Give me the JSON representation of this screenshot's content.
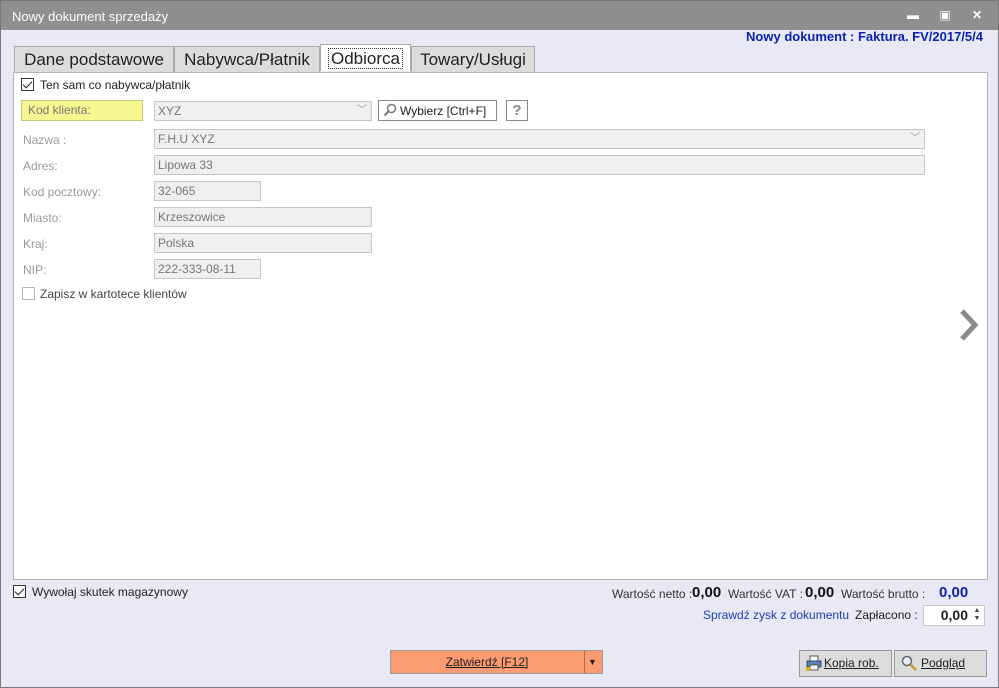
{
  "window": {
    "title": "Nowy dokument sprzedaży",
    "controls": {
      "minimize": "▬",
      "maximize": "▣",
      "close": "✕"
    }
  },
  "doc_header": "Nowy dokument : Faktura. FV/2017/5/4",
  "tabs": [
    {
      "label": "Dane podstawowe",
      "active": false
    },
    {
      "label": "Nabywca/Płatnik",
      "active": false
    },
    {
      "label": "Odbiorca",
      "active": true
    },
    {
      "label": "Towary/Usługi",
      "active": false
    }
  ],
  "form": {
    "same_as_buyer": {
      "label": "Ten sam co nabywca/płatnik",
      "checked": true
    },
    "client_code": {
      "label": "Kod klienta:",
      "value": "XYZ"
    },
    "choose_button": "Wybierz [Ctrl+F]",
    "help_button": "?",
    "name": {
      "label": "Nazwa :",
      "value": "F.H.U XYZ"
    },
    "address": {
      "label": "Adres:",
      "value": "Lipowa 33"
    },
    "postal_code": {
      "label": "Kod pocztowy:",
      "value": "32-065"
    },
    "city": {
      "label": "Miasto:",
      "value": "Krzeszowice"
    },
    "country": {
      "label": "Kraj:",
      "value": "Polska"
    },
    "nip": {
      "label": "NIP:",
      "value": "222-333-08-11"
    },
    "save_to_clients": {
      "label": "Zapisz w kartotece klientów",
      "checked": false
    }
  },
  "footer": {
    "stock_effect": {
      "label": "Wywołaj skutek magazynowy",
      "checked": true
    },
    "net_label": "Wartość netto :",
    "net_value": "0,00",
    "vat_label": "Wartość VAT :",
    "vat_value": "0,00",
    "gross_label": "Wartość brutto :",
    "gross_value": "0,00",
    "profit_link": "Sprawdź zysk z dokumentu",
    "paid_label": "Zapłacono :",
    "paid_value": "0,00",
    "confirm_button": "Zatwierdź [F12]",
    "copy_button": "Kopia rob.",
    "preview_button": "Podgląd"
  },
  "colors": {
    "title_bar": "#8f8f8f",
    "header_text": "#0b23b0",
    "client_code_highlight": "#f7f792",
    "confirm_button": "#fb9b72"
  }
}
